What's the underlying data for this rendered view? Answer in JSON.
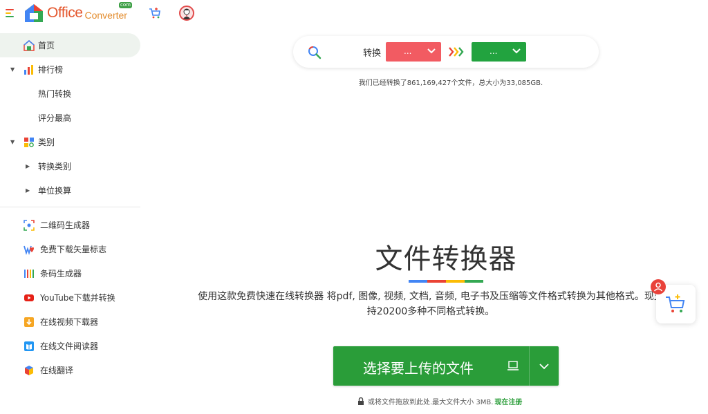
{
  "header": {
    "logo_text": "Office",
    "logo_sub": "Converter",
    "logo_com": "com",
    "menu_icon": "hamburger-icon",
    "cart_icon": "cart-plus-icon",
    "avatar_icon": "user-avatar-icon"
  },
  "sidebar": {
    "items": [
      {
        "label": "首页",
        "icon": "home-icon",
        "active": true
      },
      {
        "label": "排行榜",
        "icon": "bar-chart-icon",
        "caret": "down"
      },
      {
        "label": "热门转换"
      },
      {
        "label": "评分最高"
      },
      {
        "label": "类别",
        "icon": "grid-search-icon",
        "caret": "down"
      },
      {
        "label": "转换类别",
        "caret": "right"
      },
      {
        "label": "单位换算",
        "caret": "right"
      }
    ],
    "tools": [
      {
        "label": "二维码生成器",
        "icon": "qr-scan-icon"
      },
      {
        "label": "免费下载矢量标志",
        "icon": "vector-logo-icon"
      },
      {
        "label": "条码生成器",
        "icon": "barcode-icon"
      },
      {
        "label": "YouTube下载并转换",
        "icon": "youtube-icon"
      },
      {
        "label": "在线视频下载器",
        "icon": "video-download-icon"
      },
      {
        "label": "在线文件阅读器",
        "icon": "book-reader-icon"
      },
      {
        "label": "在线翻译",
        "icon": "translate-icon"
      }
    ]
  },
  "converter": {
    "label": "转换",
    "from_value": "...",
    "to_value": "...",
    "search_icon": "search-icon",
    "arrows_icon": "triple-chevron-right-icon"
  },
  "stats": "我们已经转换了861,169,427个文件，总大小为33,085GB.",
  "hero": {
    "title": "文件转换器",
    "description": "使用这款免费快速在线转换器 将pdf, 图像, 视频, 文档, 音频, 电子书及压缩等文件格式转换为其他格式。现支持20200多种不同格式转换。"
  },
  "upload": {
    "label": "选择要上传的文件",
    "computer_icon": "laptop-icon",
    "menu_icon": "chevron-down-icon"
  },
  "drop_hint": {
    "text": "或将文件拖放到此处.最大文件大小 3MB.",
    "register": "现在注册",
    "lock_icon": "lock-icon"
  },
  "floating": {
    "cart_icon": "cart-plus-icon",
    "badge_icon": "user-icon"
  },
  "colors": {
    "brand_green": "#2a9d39",
    "from_red": "#f25b62",
    "active_bg": "#eef3ee"
  }
}
